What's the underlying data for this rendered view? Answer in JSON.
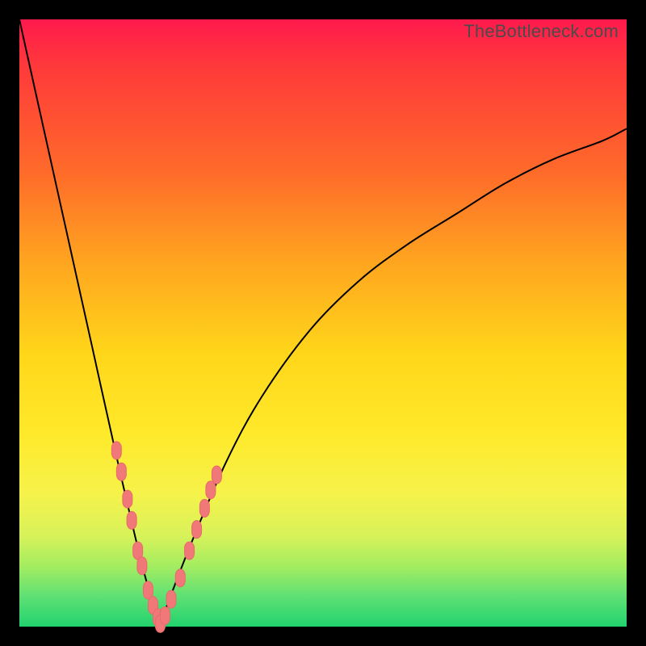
{
  "watermark": "TheBottleneck.com",
  "colors": {
    "top": "#ff1a4d",
    "mid_upper": "#ff6a2a",
    "mid": "#ffd61a",
    "mid_lower": "#d8f25a",
    "bottom": "#21d36e",
    "curve": "#000000",
    "marker": "#f07878"
  },
  "chart_data": {
    "type": "line",
    "title": "",
    "xlabel": "",
    "ylabel": "",
    "xlim": [
      0,
      100
    ],
    "ylim": [
      0,
      100
    ],
    "grid": false,
    "legend": false,
    "description": "Bottleneck-style V curve: two branches descending to near-zero at x≈23, left branch steep from (0,100) to (23,0), right branch rising with diminishing slope toward (100,~82).",
    "series": [
      {
        "name": "left-branch",
        "x": [
          0,
          4,
          8,
          12,
          16,
          20,
          23
        ],
        "values": [
          100,
          82,
          64,
          46,
          28,
          11,
          0
        ]
      },
      {
        "name": "right-branch",
        "x": [
          23,
          28,
          34,
          40,
          48,
          56,
          64,
          72,
          80,
          88,
          96,
          100
        ],
        "values": [
          0,
          13,
          27,
          38,
          49,
          57,
          63,
          68,
          73,
          77,
          80,
          82
        ]
      }
    ],
    "markers": {
      "name": "salmon-dots",
      "note": "Approximate pink lozenge markers clustered around the V vertex, shown as (x, y) pairs.",
      "points": [
        [
          16.0,
          29.0
        ],
        [
          16.8,
          25.5
        ],
        [
          17.8,
          21.0
        ],
        [
          18.5,
          17.5
        ],
        [
          19.5,
          12.5
        ],
        [
          20.2,
          10.0
        ],
        [
          21.2,
          6.0
        ],
        [
          22.0,
          3.5
        ],
        [
          22.8,
          1.5
        ],
        [
          23.2,
          0.5
        ],
        [
          24.0,
          1.8
        ],
        [
          25.0,
          4.5
        ],
        [
          26.5,
          8.0
        ],
        [
          28.0,
          12.5
        ],
        [
          29.2,
          16.0
        ],
        [
          30.5,
          19.5
        ],
        [
          31.5,
          22.5
        ],
        [
          32.5,
          25.0
        ]
      ]
    }
  }
}
